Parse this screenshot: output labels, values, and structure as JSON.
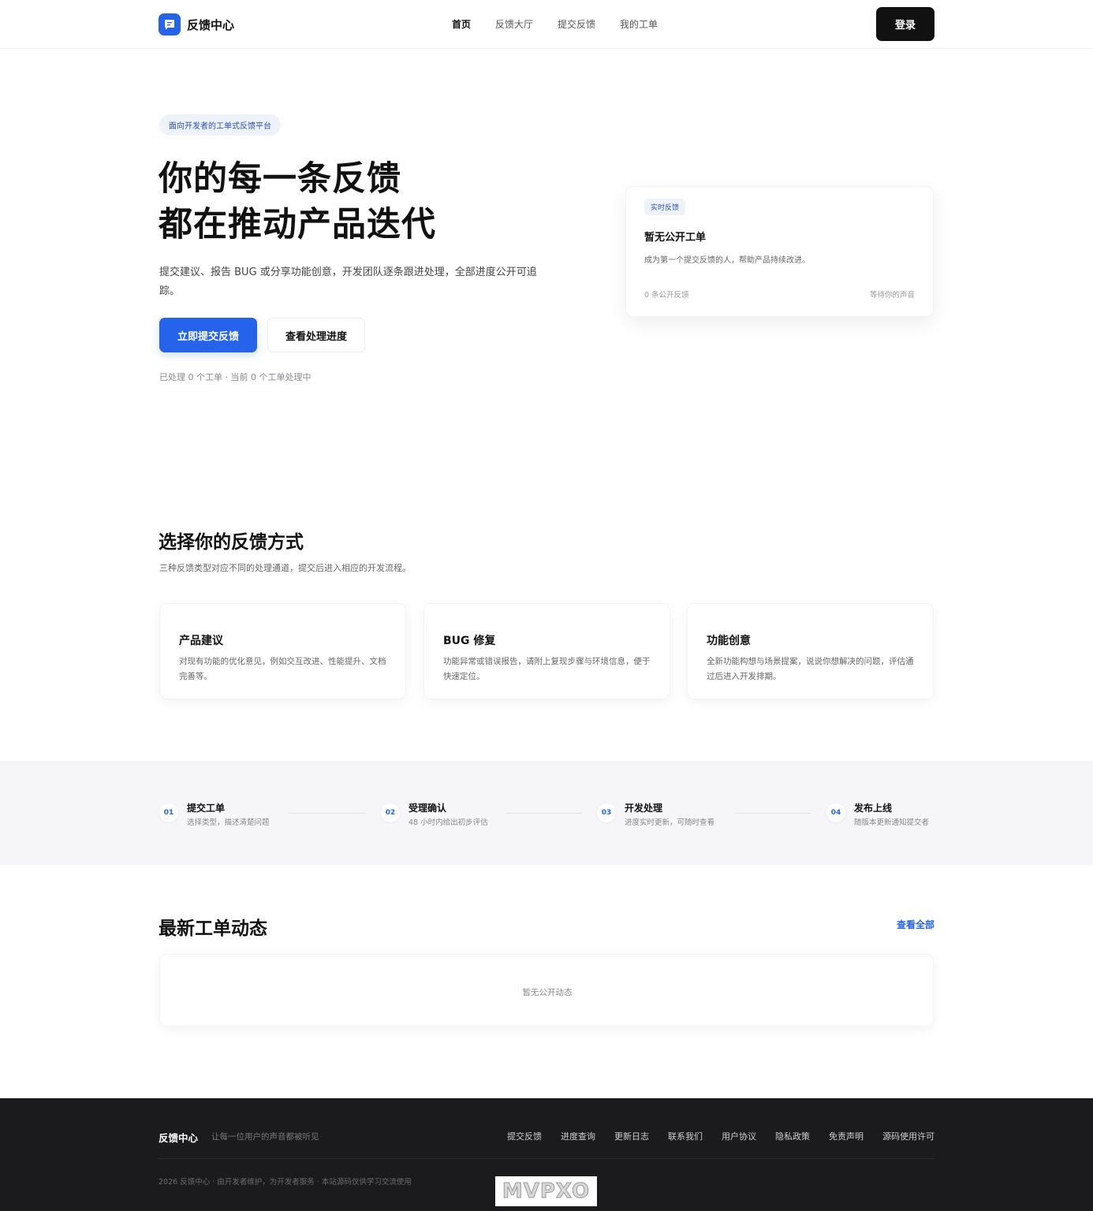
{
  "header": {
    "brand": "反馈中心",
    "nav": [
      "首页",
      "反馈大厅",
      "提交反馈",
      "我的工单"
    ],
    "login": "登录"
  },
  "hero": {
    "badge": "面向开发者的工单式反馈平台",
    "title_line1": "你的每一条反馈",
    "title_line2": "都在推动产品迭代",
    "description": "提交建议、报告 BUG 或分享功能创意，开发团队逐条跟进处理，全部进度公开可追踪。",
    "primary_button": "立即提交反馈",
    "secondary_button": "查看处理进度",
    "stats": "已处理 0 个工单 · 当前 0 个工单处理中"
  },
  "realtime_card": {
    "badge": "实时反馈",
    "title": "暂无公开工单",
    "description": "成为第一个提交反馈的人，帮助产品持续改进。",
    "count": "0 条公开反馈",
    "waiting": "等待你的声音"
  },
  "types_section": {
    "title": "选择你的反馈方式",
    "description": "三种反馈类型对应不同的处理通道，提交后进入相应的开发流程。",
    "cards": [
      {
        "title": "产品建议",
        "description": "对现有功能的优化意见，例如交互改进、性能提升、文档完善等。"
      },
      {
        "title": "BUG 修复",
        "description": "功能异常或错误报告，请附上复现步骤与环境信息，便于快速定位。"
      },
      {
        "title": "功能创意",
        "description": "全新功能构想与场景提案，说说你想解决的问题，评估通过后进入开发排期。"
      }
    ]
  },
  "steps": [
    {
      "num": "01",
      "title": "提交工单",
      "description": "选择类型，描述清楚问题"
    },
    {
      "num": "02",
      "title": "受理确认",
      "description": "48 小时内给出初步评估"
    },
    {
      "num": "03",
      "title": "开发处理",
      "description": "进度实时更新，可随时查看"
    },
    {
      "num": "04",
      "title": "发布上线",
      "description": "随版本更新通知提交者"
    }
  ],
  "latest": {
    "title": "最新工单动态",
    "view_all": "查看全部",
    "empty": "暂无公开动态"
  },
  "footer": {
    "brand": "反馈中心",
    "slogan": "让每一位用户的声音都被听见",
    "links": [
      "提交反馈",
      "进度查询",
      "更新日志",
      "联系我们",
      "用户协议",
      "隐私政策",
      "免责声明",
      "源码使用许可"
    ],
    "copyright": "2026 反馈中心 · 由开发者维护，为开发者服务 · 本站源码仅供学习交流使用"
  },
  "watermark": "MVPXO",
  "colors": {
    "accent": "#2563eb",
    "dark": "#111111",
    "footer_bg": "#1b1b1d",
    "steps_bg": "#f6f6f8"
  }
}
